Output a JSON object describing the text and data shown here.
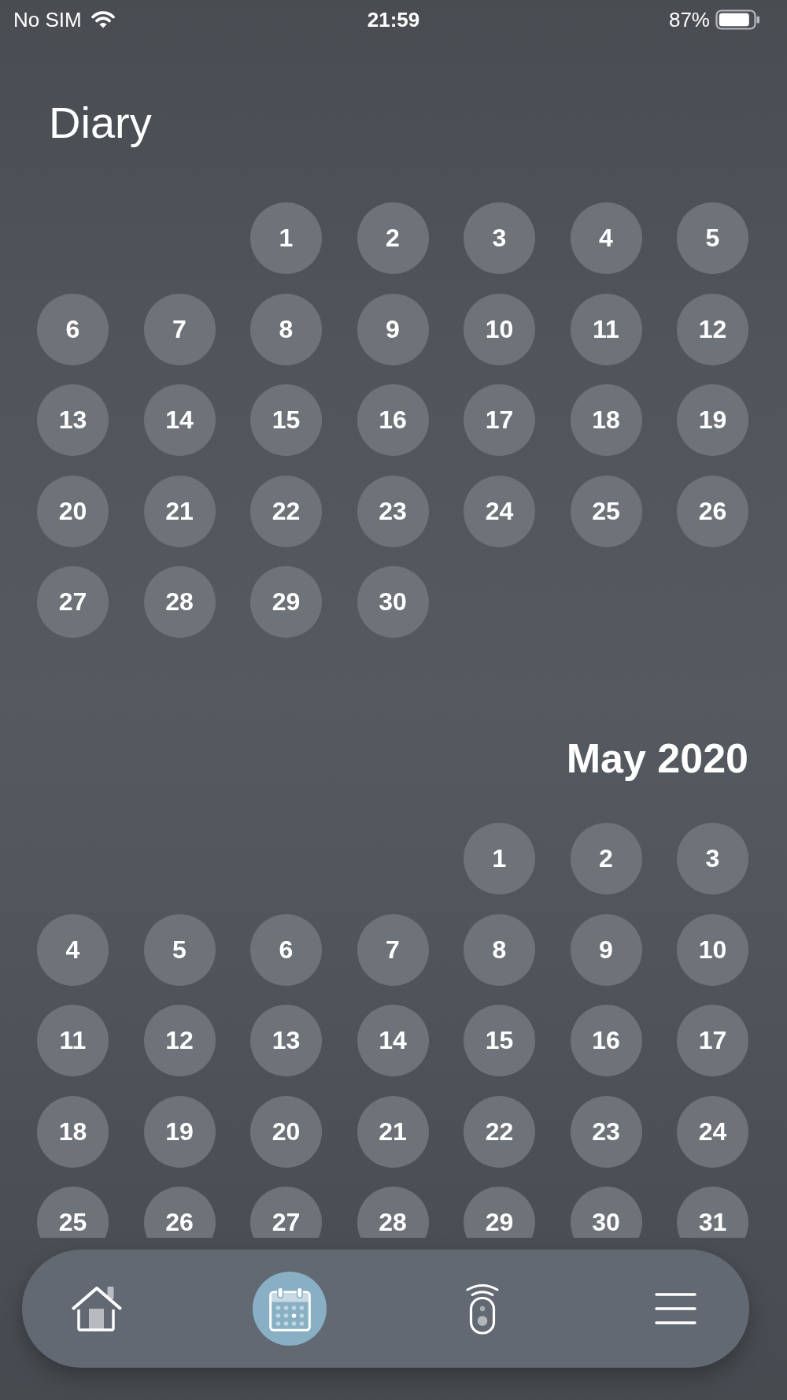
{
  "status_bar": {
    "carrier": "No SIM",
    "time": "21:59",
    "battery": "87%"
  },
  "header": {
    "title": "Diary"
  },
  "months": [
    {
      "weeks": [
        [
          "1",
          "2",
          "3",
          "4",
          "5"
        ],
        [
          "6",
          "7",
          "8",
          "9",
          "10",
          "11",
          "12"
        ],
        [
          "13",
          "14",
          "15",
          "16",
          "17",
          "18",
          "19"
        ],
        [
          "20",
          "21",
          "22",
          "23",
          "24",
          "25",
          "26"
        ],
        [
          "27",
          "28",
          "29",
          "30"
        ]
      ]
    },
    {
      "title": "May 2020",
      "weeks": [
        [
          "1",
          "2",
          "3"
        ],
        [
          "4",
          "5",
          "6",
          "7",
          "8",
          "9",
          "10"
        ],
        [
          "11",
          "12",
          "13",
          "14",
          "15",
          "16",
          "17"
        ],
        [
          "18",
          "19",
          "20",
          "21",
          "22",
          "23",
          "24"
        ],
        [
          "25",
          "26",
          "27",
          "28",
          "29",
          "30",
          "31"
        ]
      ]
    }
  ],
  "tab_bar": {
    "tabs": [
      {
        "selected": false
      },
      {
        "selected": true
      },
      {
        "selected": false
      },
      {
        "selected": false
      }
    ]
  }
}
